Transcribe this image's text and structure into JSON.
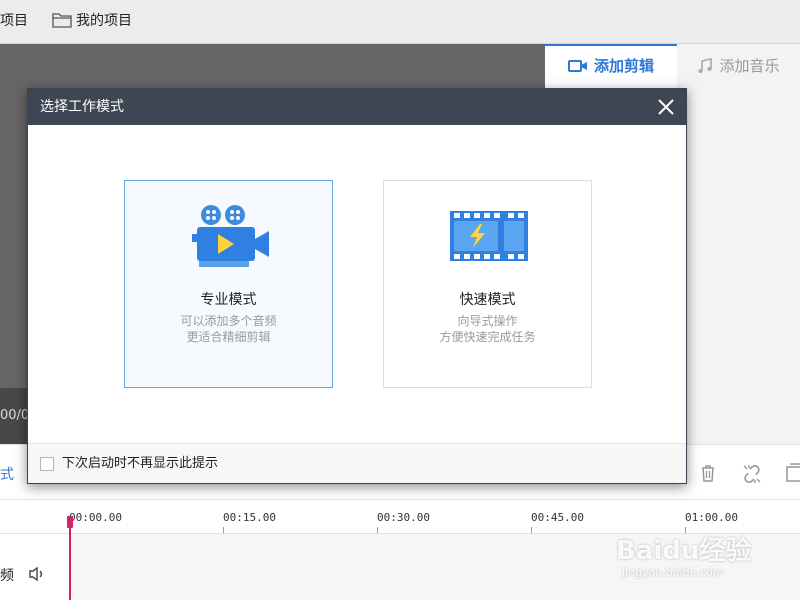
{
  "topbar": {
    "item_fragment": "项目",
    "my_projects": "我的项目"
  },
  "preview": {
    "time_fragment": "00/0"
  },
  "right_panel": {
    "tabs": [
      {
        "label": "添加剪辑",
        "icon": "video-camera-icon",
        "active": true
      },
      {
        "label": "添加音乐",
        "icon": "music-note-icon",
        "active": false
      }
    ]
  },
  "toolbar": {
    "mode_fragment": "式",
    "icons": [
      "trash-icon",
      "unlink-icon",
      "copy-icon"
    ]
  },
  "timeline": {
    "ticks": [
      "00:00.00",
      "00:15.00",
      "00:30.00",
      "00:45.00",
      "01:00.00"
    ],
    "track_fragment": "频",
    "track_icon": "speaker-icon",
    "playhead_color": "#d0246a"
  },
  "dialog": {
    "title": "选择工作模式",
    "close_icon": "close-icon",
    "modes": [
      {
        "title": "专业模式",
        "desc_line1": "可以添加多个音频",
        "desc_line2": "更适合精细剪辑",
        "icon": "movie-camera-icon",
        "selected": true
      },
      {
        "title": "快速模式",
        "desc_line1": "向导式操作",
        "desc_line2": "方便快速完成任务",
        "icon": "film-strip-icon",
        "selected": false
      }
    ],
    "dont_show_again": "下次启动时不再显示此提示",
    "dont_show_again_checked": false
  },
  "watermark": {
    "brand": "Baidu经验",
    "url": "jingyan.baidu.com"
  },
  "colors": {
    "accent": "#2e78d8",
    "dialog_header": "#3e4553",
    "selected_border": "#64a7e8"
  }
}
